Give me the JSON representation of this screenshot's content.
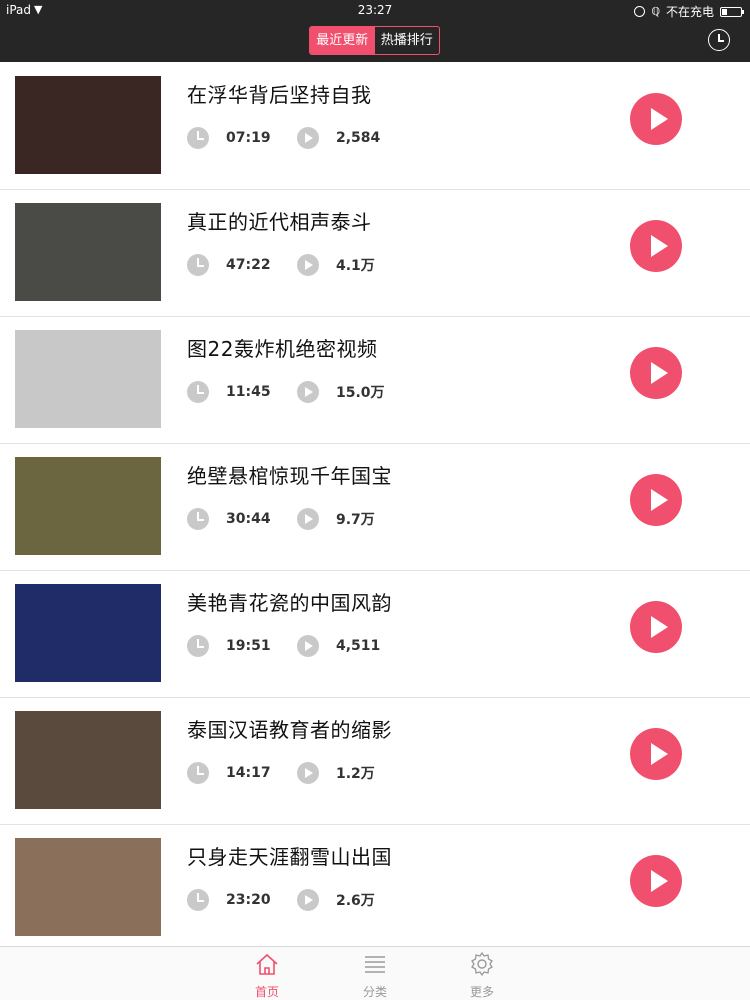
{
  "status_bar": {
    "carrier": "iPad",
    "time": "23:27",
    "charging_text": "不在充电",
    "battery_level": 0.25
  },
  "header": {
    "tabs": [
      {
        "label": "最近更新",
        "active": true
      },
      {
        "label": "热播排行",
        "active": false
      }
    ],
    "history_icon": "clock-icon"
  },
  "videos": [
    {
      "title": "在浮华背后坚持自我",
      "duration": "07:19",
      "views": "2,584",
      "thumb_color": "#3a2622"
    },
    {
      "title": "真正的近代相声泰斗",
      "duration": "47:22",
      "views": "4.1万",
      "thumb_color": "#4a4a46"
    },
    {
      "title": "图22轰炸机绝密视频",
      "duration": "11:45",
      "views": "15.0万",
      "thumb_color": "#c8c8c8"
    },
    {
      "title": "绝壁悬棺惊现千年国宝",
      "duration": "30:44",
      "views": "9.7万",
      "thumb_color": "#6b6540"
    },
    {
      "title": "美艳青花瓷的中国风韵",
      "duration": "19:51",
      "views": "4,511",
      "thumb_color": "#1f2c68"
    },
    {
      "title": "泰国汉语教育者的缩影",
      "duration": "14:17",
      "views": "1.2万",
      "thumb_color": "#5a4a3e"
    },
    {
      "title": "只身走天涯翻雪山出国",
      "duration": "23:20",
      "views": "2.6万",
      "thumb_color": "#8a6f5a"
    }
  ],
  "tabbar": {
    "items": [
      {
        "label": "首页",
        "icon": "home-icon",
        "active": true
      },
      {
        "label": "分类",
        "icon": "list-icon",
        "active": false
      },
      {
        "label": "更多",
        "icon": "gear-icon",
        "active": false
      }
    ]
  },
  "colors": {
    "accent": "#f0506e",
    "topbar": "#262626",
    "meta_icon": "#c9c9c9"
  }
}
